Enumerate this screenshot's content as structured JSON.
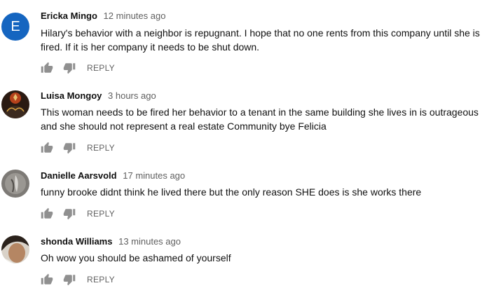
{
  "comments": [
    {
      "author": "Ericka Mingo",
      "time": "12 minutes ago",
      "avatar_letter": "E",
      "text": "Hilary's behavior with a neighbor is repugnant. I hope that no one rents from this company until she is fired. If it is her company it needs to be shut down.",
      "reply_label": "REPLY"
    },
    {
      "author": "Luisa Mongoy",
      "time": "3 hours ago",
      "text": "This woman needs to be fired her behavior to a tenant in the same building she lives in is outrageous and she should not represent a real estate Community bye Felicia",
      "reply_label": "REPLY"
    },
    {
      "author": "Danielle Aarsvold",
      "time": "17 minutes ago",
      "text": "funny brooke didnt think he lived there but the only reason SHE does is she works there",
      "reply_label": "REPLY"
    },
    {
      "author": "shonda Williams",
      "time": "13 minutes ago",
      "text": "Oh wow you should be ashamed of yourself",
      "reply_label": "REPLY"
    }
  ],
  "icons": {
    "like": "thumbs-up-icon",
    "dislike": "thumbs-down-icon"
  },
  "colors": {
    "avatar_letter_bg": "#1565c0",
    "meta_gray": "#606060",
    "icon_gray": "#909090"
  }
}
